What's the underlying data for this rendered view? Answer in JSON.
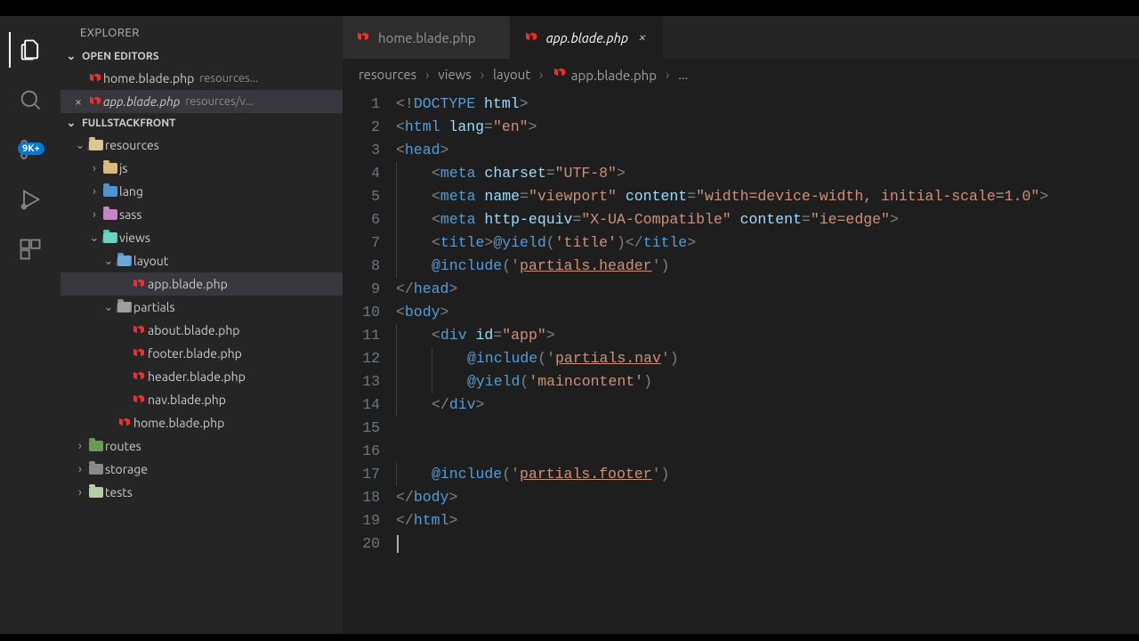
{
  "explorer": {
    "title": "EXPLORER",
    "openEditorsLabel": "OPEN EDITORS",
    "workspaceLabel": "FULLSTACKFRONT",
    "badge": "9K+"
  },
  "openEditors": [
    {
      "name": "home.blade.php",
      "meta": "resources...",
      "dirty": false,
      "active": false,
      "italic": false
    },
    {
      "name": "app.blade.php",
      "meta": "resources/v...",
      "dirty": false,
      "active": true,
      "italic": true
    }
  ],
  "tree": [
    {
      "depth": 0,
      "type": "folder",
      "open": true,
      "name": "resources",
      "color": "c-yellow"
    },
    {
      "depth": 1,
      "type": "folder",
      "open": false,
      "name": "js",
      "color": "c-yellow"
    },
    {
      "depth": 1,
      "type": "folder",
      "open": false,
      "name": "lang",
      "color": "c-blue"
    },
    {
      "depth": 1,
      "type": "folder",
      "open": false,
      "name": "sass",
      "color": "c-pink"
    },
    {
      "depth": 1,
      "type": "folder",
      "open": true,
      "name": "views",
      "color": "c-teal"
    },
    {
      "depth": 2,
      "type": "folder",
      "open": true,
      "name": "layout",
      "color": "c-blue"
    },
    {
      "depth": 3,
      "type": "file",
      "name": "app.blade.php",
      "selected": true
    },
    {
      "depth": 2,
      "type": "folder",
      "open": true,
      "name": "partials",
      "color": "c-grey"
    },
    {
      "depth": 3,
      "type": "file",
      "name": "about.blade.php"
    },
    {
      "depth": 3,
      "type": "file",
      "name": "footer.blade.php"
    },
    {
      "depth": 3,
      "type": "file",
      "name": "header.blade.php"
    },
    {
      "depth": 3,
      "type": "file",
      "name": "nav.blade.php"
    },
    {
      "depth": 2,
      "type": "file",
      "name": "home.blade.php"
    },
    {
      "depth": 0,
      "type": "folder",
      "open": false,
      "name": "routes",
      "color": "c-green"
    },
    {
      "depth": 0,
      "type": "folder",
      "open": false,
      "name": "storage",
      "color": "c-grey"
    },
    {
      "depth": 0,
      "type": "folder",
      "open": false,
      "name": "tests",
      "color": "c-lime"
    }
  ],
  "tabs": [
    {
      "name": "home.blade.php",
      "active": false,
      "italic": false,
      "closable": false
    },
    {
      "name": "app.blade.php",
      "active": true,
      "italic": true,
      "closable": true
    }
  ],
  "breadcrumb": [
    "resources",
    "views",
    "layout",
    "app.blade.php",
    "..."
  ],
  "code": {
    "lines": [
      [
        {
          "t": "pun",
          "v": "<!"
        },
        {
          "t": "tag",
          "v": "DOCTYPE "
        },
        {
          "t": "attr",
          "v": "html"
        },
        {
          "t": "pun",
          "v": ">"
        }
      ],
      [
        {
          "t": "pun",
          "v": "<"
        },
        {
          "t": "tag",
          "v": "html "
        },
        {
          "t": "attr",
          "v": "lang"
        },
        {
          "t": "pun",
          "v": "="
        },
        {
          "t": "str",
          "v": "\"en\""
        },
        {
          "t": "pun",
          "v": ">"
        }
      ],
      [
        {
          "t": "pun",
          "v": "<"
        },
        {
          "t": "tag",
          "v": "head"
        },
        {
          "t": "pun",
          "v": ">"
        }
      ],
      [
        {
          "t": "ind",
          "v": 1
        },
        {
          "t": "pun",
          "v": "<"
        },
        {
          "t": "tag",
          "v": "meta "
        },
        {
          "t": "attr",
          "v": "charset"
        },
        {
          "t": "pun",
          "v": "="
        },
        {
          "t": "str",
          "v": "\"UTF-8\""
        },
        {
          "t": "pun",
          "v": ">"
        }
      ],
      [
        {
          "t": "ind",
          "v": 1
        },
        {
          "t": "pun",
          "v": "<"
        },
        {
          "t": "tag",
          "v": "meta "
        },
        {
          "t": "attr",
          "v": "name"
        },
        {
          "t": "pun",
          "v": "="
        },
        {
          "t": "str",
          "v": "\"viewport\""
        },
        {
          "t": "attr",
          "v": " content"
        },
        {
          "t": "pun",
          "v": "="
        },
        {
          "t": "str",
          "v": "\"width=device-width, initial-scale=1.0\""
        },
        {
          "t": "pun",
          "v": ">"
        }
      ],
      [
        {
          "t": "ind",
          "v": 1
        },
        {
          "t": "pun",
          "v": "<"
        },
        {
          "t": "tag",
          "v": "meta "
        },
        {
          "t": "attr",
          "v": "http-equiv"
        },
        {
          "t": "pun",
          "v": "="
        },
        {
          "t": "str",
          "v": "\"X-UA-Compatible\""
        },
        {
          "t": "attr",
          "v": " content"
        },
        {
          "t": "pun",
          "v": "="
        },
        {
          "t": "str",
          "v": "\"ie=edge\""
        },
        {
          "t": "pun",
          "v": ">"
        }
      ],
      [
        {
          "t": "ind",
          "v": 1
        },
        {
          "t": "pun",
          "v": "<"
        },
        {
          "t": "tag",
          "v": "title"
        },
        {
          "t": "pun",
          "v": ">"
        },
        {
          "t": "dir",
          "v": "@yield"
        },
        {
          "t": "pun",
          "v": "("
        },
        {
          "t": "dirargp",
          "v": "'title'"
        },
        {
          "t": "pun",
          "v": ")"
        },
        {
          "t": "pun",
          "v": "</"
        },
        {
          "t": "tag",
          "v": "title"
        },
        {
          "t": "pun",
          "v": ">"
        }
      ],
      [
        {
          "t": "ind",
          "v": 1
        },
        {
          "t": "dir",
          "v": "@include"
        },
        {
          "t": "pun",
          "v": "('"
        },
        {
          "t": "dirarg",
          "v": "partials.header"
        },
        {
          "t": "pun",
          "v": "')"
        }
      ],
      [
        {
          "t": "pun",
          "v": "</"
        },
        {
          "t": "tag",
          "v": "head"
        },
        {
          "t": "pun",
          "v": ">"
        }
      ],
      [
        {
          "t": "pun",
          "v": "<"
        },
        {
          "t": "tag",
          "v": "body"
        },
        {
          "t": "pun",
          "v": ">"
        }
      ],
      [
        {
          "t": "ind",
          "v": 1
        },
        {
          "t": "pun",
          "v": "<"
        },
        {
          "t": "tag",
          "v": "div "
        },
        {
          "t": "attr",
          "v": "id"
        },
        {
          "t": "pun",
          "v": "="
        },
        {
          "t": "str",
          "v": "\"app\""
        },
        {
          "t": "pun",
          "v": ">"
        }
      ],
      [
        {
          "t": "ind",
          "v": 2
        },
        {
          "t": "dir",
          "v": "@include"
        },
        {
          "t": "pun",
          "v": "('"
        },
        {
          "t": "dirarg",
          "v": "partials.nav"
        },
        {
          "t": "pun",
          "v": "')"
        }
      ],
      [
        {
          "t": "ind",
          "v": 2
        },
        {
          "t": "dir",
          "v": "@yield"
        },
        {
          "t": "pun",
          "v": "("
        },
        {
          "t": "dirargp",
          "v": "'maincontent'"
        },
        {
          "t": "pun",
          "v": ")"
        }
      ],
      [
        {
          "t": "ind",
          "v": 1
        },
        {
          "t": "pun",
          "v": "</"
        },
        {
          "t": "tag",
          "v": "div"
        },
        {
          "t": "pun",
          "v": ">"
        }
      ],
      [],
      [],
      [
        {
          "t": "ind",
          "v": 1
        },
        {
          "t": "dir",
          "v": "@include"
        },
        {
          "t": "pun",
          "v": "('"
        },
        {
          "t": "dirarg",
          "v": "partials.footer"
        },
        {
          "t": "pun",
          "v": "')"
        }
      ],
      [
        {
          "t": "pun",
          "v": "</"
        },
        {
          "t": "tag",
          "v": "body"
        },
        {
          "t": "pun",
          "v": ">"
        }
      ],
      [
        {
          "t": "pun",
          "v": "</"
        },
        {
          "t": "tag",
          "v": "html"
        },
        {
          "t": "pun",
          "v": ">"
        }
      ],
      [
        {
          "t": "cursor",
          "v": ""
        }
      ]
    ]
  }
}
